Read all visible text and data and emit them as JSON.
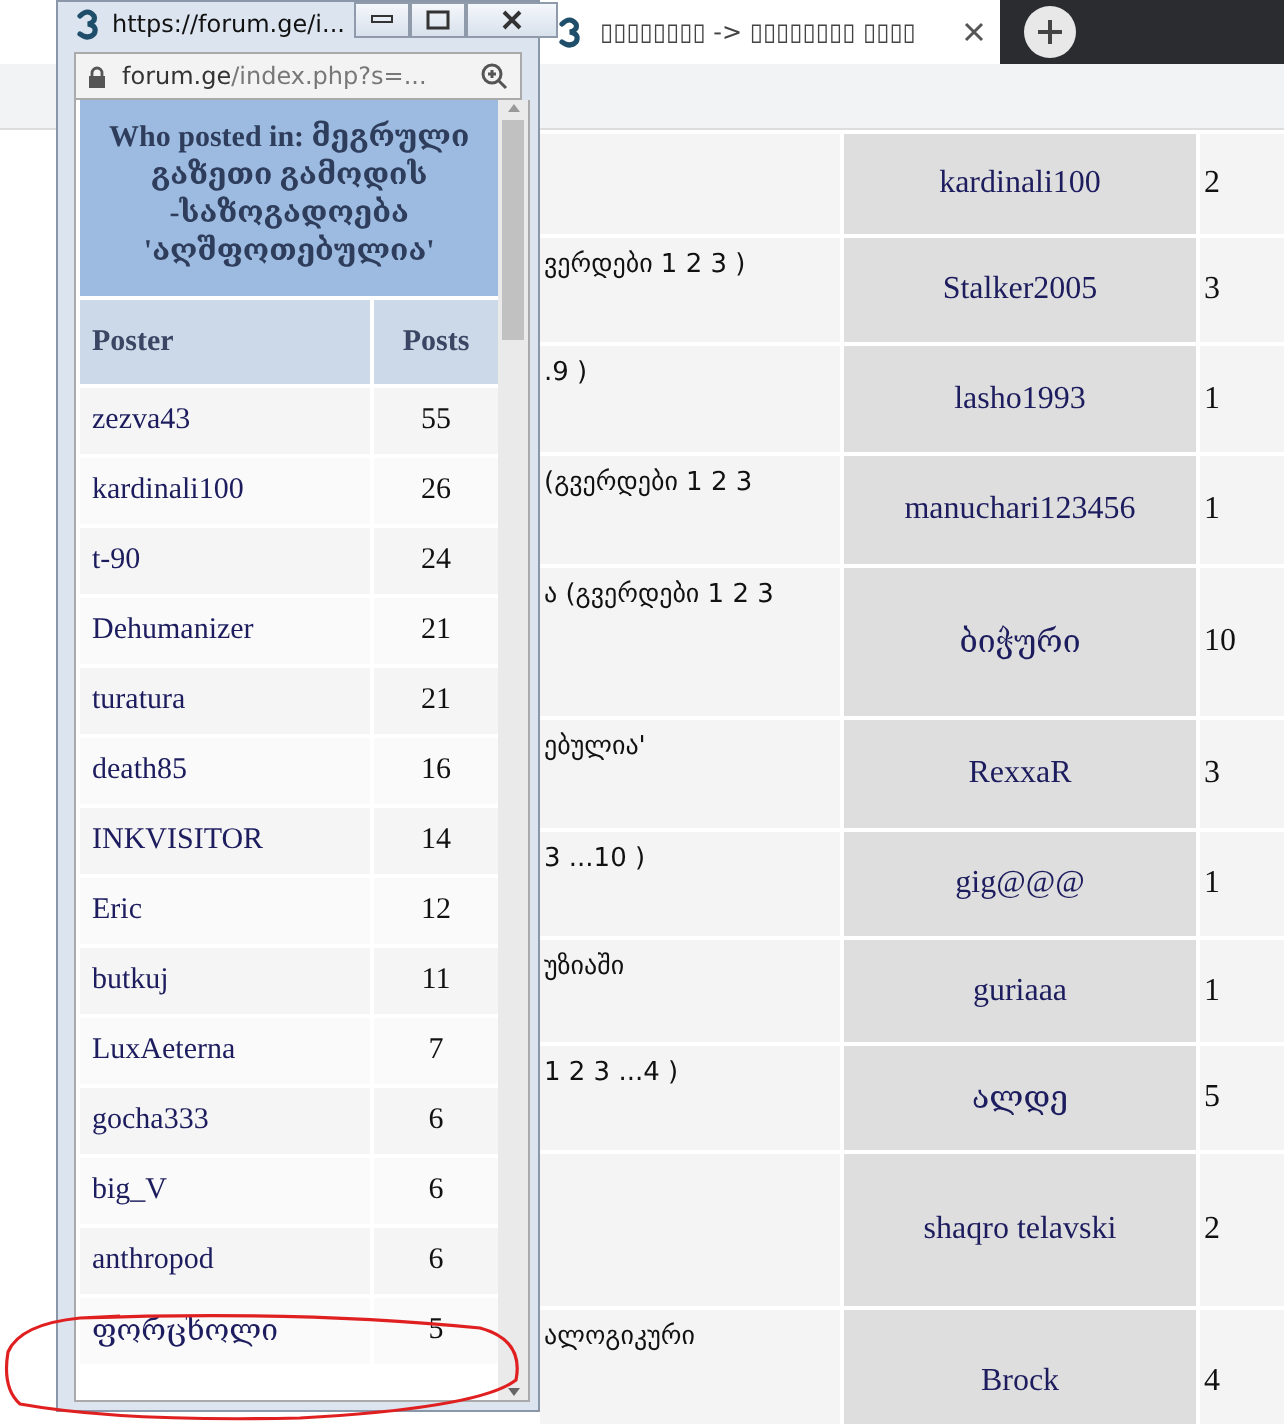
{
  "browser": {
    "tab_title": "▯▯▯▯▯▯▯▯ -> ▯▯▯▯▯▯▯▯ ▯▯▯▯",
    "rows": [
      {
        "poster": "kardinali100",
        "count": "2"
      },
      {
        "topic": "ვერდები 1 2 3 )",
        "poster": "Stalker2005",
        "count": "3"
      },
      {
        "topic": ".9 )",
        "poster": "lasho1993",
        "count": "1"
      },
      {
        "topic": "(გვერდები 1 2 3",
        "poster": "manuchari123456",
        "count": "1"
      },
      {
        "topic": "ა (გვერდები 1 2 3",
        "poster": "ბიჭური",
        "count": "10"
      },
      {
        "topic": "ებულია'",
        "poster": "RexxaR",
        "count": "3"
      },
      {
        "topic": "3 ...10 )",
        "poster": "gig@@@",
        "count": "1"
      },
      {
        "topic": "უზიაში",
        "poster": "guriaaa",
        "count": "1"
      },
      {
        "topic": "1 2 3 ...4 )",
        "poster": "ალდე",
        "count": "5"
      },
      {
        "poster": "shaqro telavski",
        "count": "2"
      },
      {
        "topic": "ალოგიკური",
        "poster": "Brock",
        "count": "4"
      }
    ]
  },
  "popup": {
    "title": "https://forum.ge/i...",
    "address_domain": "forum.ge",
    "address_path": "/index.php?s=...",
    "heading": "Who posted in: მეგრული გაზეთი გამოდის -საზოგადოება 'აღშფოთებულია'",
    "columns": [
      "Poster",
      "Posts"
    ],
    "rows": [
      {
        "poster": "zezva43",
        "posts": "55"
      },
      {
        "poster": "kardinali100",
        "posts": "26"
      },
      {
        "poster": "t-90",
        "posts": "24"
      },
      {
        "poster": "Dehumanizer",
        "posts": "21"
      },
      {
        "poster": "turatura",
        "posts": "21"
      },
      {
        "poster": "death85",
        "posts": "16"
      },
      {
        "poster": "INKVISITOR",
        "posts": "14"
      },
      {
        "poster": "Eric",
        "posts": "12"
      },
      {
        "poster": "butkuj",
        "posts": "11"
      },
      {
        "poster": "LuxAeterna",
        "posts": "7"
      },
      {
        "poster": "gocha333",
        "posts": "6"
      },
      {
        "poster": "big_V",
        "posts": "6"
      },
      {
        "poster": "anthropod",
        "posts": "6"
      },
      {
        "poster": "ფორცხოლი",
        "posts": "5"
      }
    ]
  }
}
